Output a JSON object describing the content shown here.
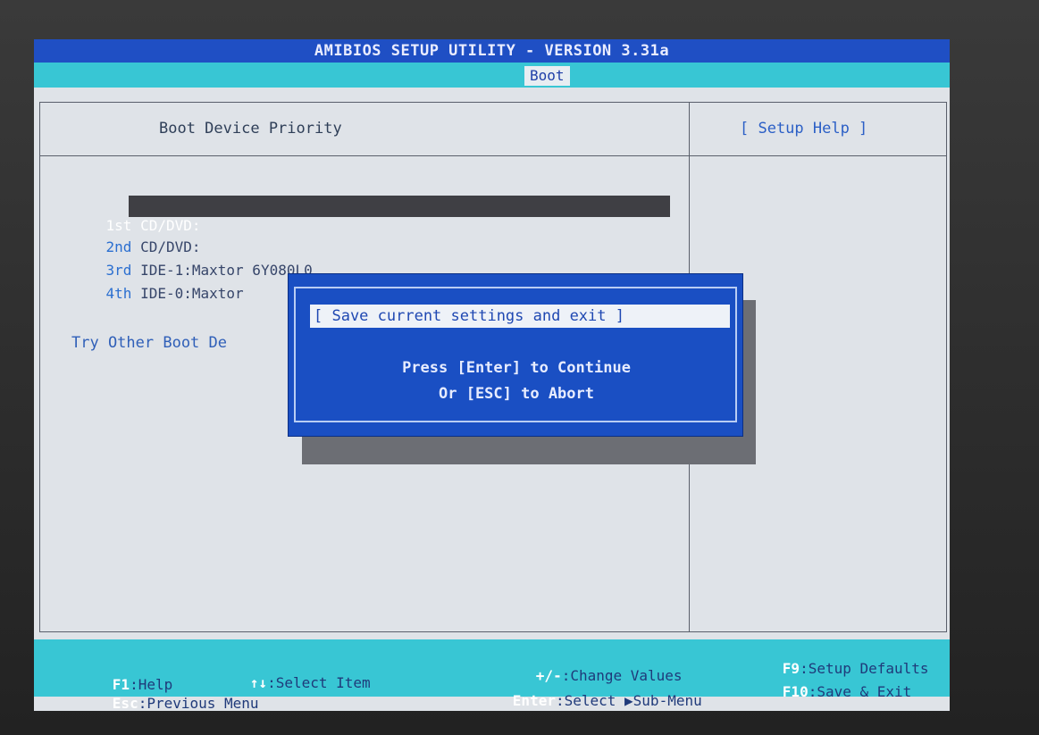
{
  "title_bar": {
    "text": "AMIBIOS SETUP UTILITY - VERSION 3.31a"
  },
  "tabs": {
    "active": "Boot"
  },
  "main": {
    "section_title": "Boot Device Priority",
    "boot_items": [
      {
        "ord": "1st",
        "value": "CD/DVD:"
      },
      {
        "ord": "2nd",
        "value": "CD/DVD:"
      },
      {
        "ord": "3rd",
        "value": "IDE-1:Maxtor 6Y080L0"
      },
      {
        "ord": "4th",
        "value": "IDE-0:Maxtor"
      }
    ],
    "other_boot": "Try Other Boot De"
  },
  "help": {
    "title": "[  Setup Help  ]"
  },
  "dialog": {
    "title": "[ Save current settings and exit ]",
    "line1": "Press [Enter] to Continue",
    "line2": "Or [ESC] to Abort"
  },
  "footer": {
    "f1": {
      "key": "F1",
      "text": ":Help"
    },
    "arrows": {
      "key": "↑↓",
      "text": ":Select Item"
    },
    "esc": {
      "key": "Esc",
      "text": ":Previous Menu"
    },
    "plusminus": {
      "key": "+/-",
      "text": ":Change Values"
    },
    "enter": {
      "key": "Enter",
      "text": ":Select ▶Sub-Menu"
    },
    "f9": {
      "key": "F9",
      "text": ":Setup Defaults"
    },
    "f10": {
      "key": "F10",
      "text": ":Save & Exit"
    }
  },
  "colors": {
    "title_bg": "#1f4fc4",
    "tab_bg": "#38c6d4",
    "screen_bg": "#dfe3e8",
    "dialog_bg": "#1a4fc3",
    "selection_bg": "#3f3f44"
  }
}
